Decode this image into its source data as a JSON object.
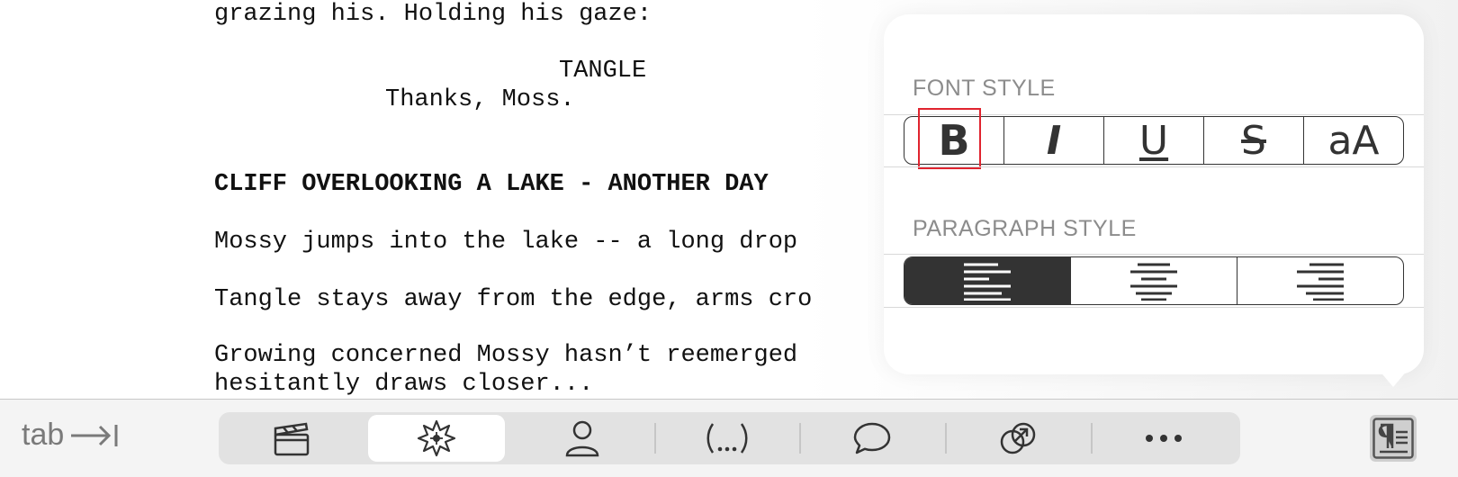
{
  "script": {
    "lines": [
      {
        "text": "grazing his. Holding his gaze:",
        "bold": false
      },
      {
        "text": "TANGLE",
        "bold": false
      },
      {
        "text": "Thanks, Moss.",
        "bold": false
      },
      {
        "text": "CLIFF OVERLOOKING A LAKE - ANOTHER DAY",
        "bold": true
      },
      {
        "text": "Mossy jumps into the lake -- a long drop",
        "bold": false
      },
      {
        "text": "Tangle stays away from the edge, arms cro",
        "bold": false
      },
      {
        "text": "Growing concerned Mossy hasn’t reemerged",
        "bold": false
      },
      {
        "text": "hesitantly draws closer...",
        "bold": false
      }
    ]
  },
  "popover": {
    "font_style_label": "FONT STYLE",
    "font_style_buttons": [
      {
        "name": "bold",
        "glyph": "B",
        "selected": false,
        "highlighted": true
      },
      {
        "name": "italic",
        "glyph": "I",
        "selected": false
      },
      {
        "name": "underline",
        "glyph": "U",
        "selected": false
      },
      {
        "name": "strikethrough",
        "glyph": "S",
        "selected": false
      },
      {
        "name": "case",
        "glyph": "aA",
        "selected": false
      }
    ],
    "paragraph_style_label": "PARAGRAPH STYLE",
    "paragraph_style_buttons": [
      {
        "name": "align-left",
        "selected": true
      },
      {
        "name": "align-center",
        "selected": false
      },
      {
        "name": "align-right",
        "selected": false
      }
    ]
  },
  "toolbar": {
    "tab_label": "tab",
    "tab_icon": "tab-arrow-icon",
    "tools": [
      {
        "name": "scene-heading",
        "icon": "clapperboard-icon",
        "selected": false
      },
      {
        "name": "action",
        "icon": "burst-icon",
        "selected": true
      },
      {
        "name": "character",
        "icon": "person-icon",
        "selected": false
      },
      {
        "name": "parenthetical",
        "icon": "parenthetical-icon",
        "selected": false
      },
      {
        "name": "dialogue",
        "icon": "speech-bubble-icon",
        "selected": false
      },
      {
        "name": "transition",
        "icon": "transition-icon",
        "selected": false
      },
      {
        "name": "more",
        "icon": "ellipsis-icon",
        "selected": false
      }
    ],
    "format_icon": "paragraph-format-icon"
  },
  "colors": {
    "accent_dark": "#333333",
    "highlight_red": "#e0242f",
    "label_gray": "#8c8c8c"
  }
}
